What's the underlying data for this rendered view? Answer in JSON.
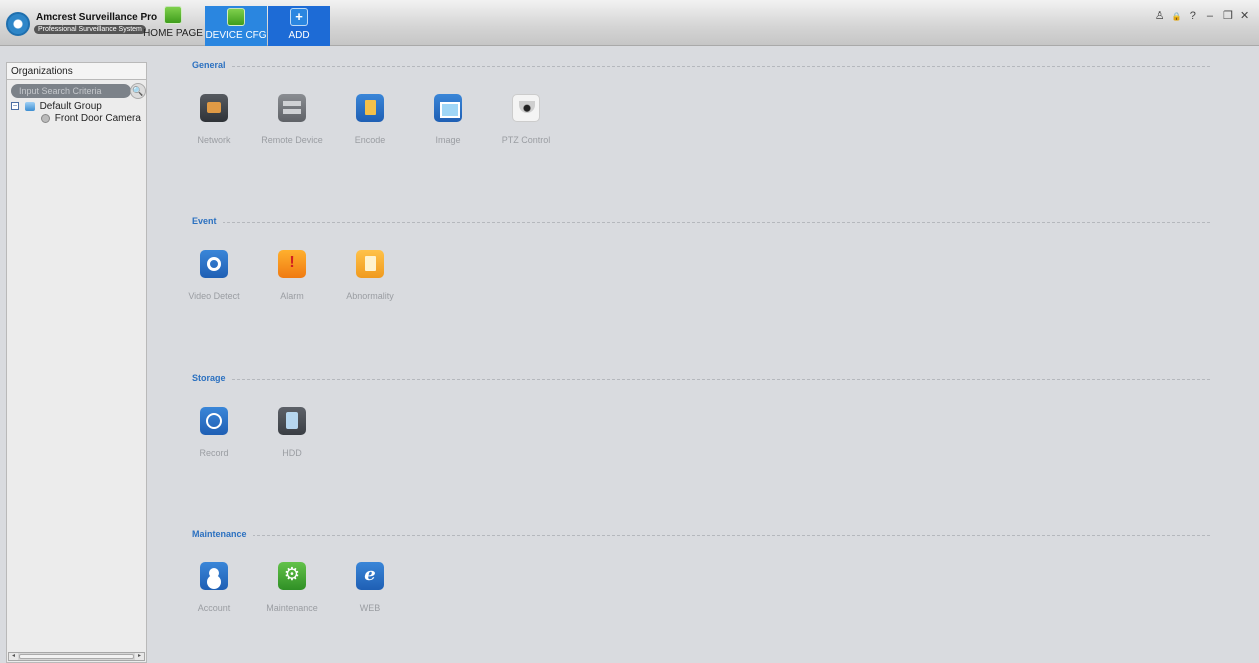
{
  "app": {
    "title": "Amcrest Surveillance Pro",
    "subtitle": "Professional Surveillance System"
  },
  "top_tabs": [
    {
      "label": "HOME PAGE",
      "icon": "home-icon",
      "active": false
    },
    {
      "label": "DEVICE CFG",
      "icon": "device-cfg-icon",
      "active": true
    },
    {
      "label": "ADD",
      "icon": "add-icon",
      "active": false
    }
  ],
  "window_controls": {
    "user": "♙",
    "lock": "🔒",
    "help": "?",
    "minimize": "–",
    "restore": "❐",
    "close": "✕"
  },
  "sidebar": {
    "title": "Organizations",
    "search_placeholder": "Input Search Criteria",
    "tree": {
      "group_label": "Default Group",
      "group_toggle": "−",
      "device_label": "Front Door Camera"
    },
    "scroll": {
      "left": "◂",
      "right": "▸"
    }
  },
  "sections": {
    "general": {
      "title": "General",
      "items": [
        {
          "label": "Network",
          "icon": "network-icon"
        },
        {
          "label": "Remote Device",
          "icon": "remote-device-icon"
        },
        {
          "label": "Encode",
          "icon": "encode-icon"
        },
        {
          "label": "Image",
          "icon": "image-icon"
        },
        {
          "label": "PTZ Control",
          "icon": "ptz-control-icon"
        }
      ]
    },
    "event": {
      "title": "Event",
      "items": [
        {
          "label": "Video Detect",
          "icon": "video-detect-icon"
        },
        {
          "label": "Alarm",
          "icon": "alarm-icon"
        },
        {
          "label": "Abnormality",
          "icon": "abnormality-icon"
        }
      ]
    },
    "storage": {
      "title": "Storage",
      "items": [
        {
          "label": "Record",
          "icon": "record-icon"
        },
        {
          "label": "HDD",
          "icon": "hdd-icon"
        }
      ]
    },
    "maintenance": {
      "title": "Maintenance",
      "items": [
        {
          "label": "Account",
          "icon": "account-icon"
        },
        {
          "label": "Maintenance",
          "icon": "maintenance-icon"
        },
        {
          "label": "WEB",
          "icon": "web-icon"
        }
      ]
    }
  },
  "colors": {
    "accent": "#2a86e0",
    "section_title": "#2c71c0",
    "background": "#d9dbdf"
  }
}
